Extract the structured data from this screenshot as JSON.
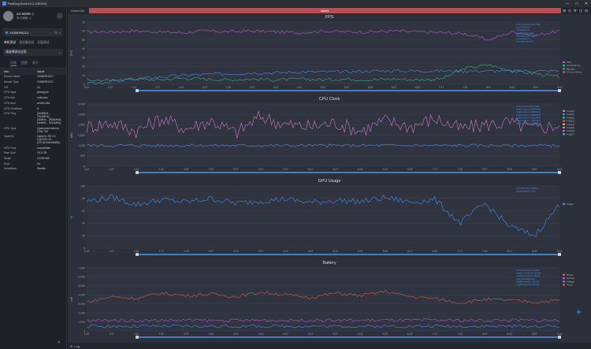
{
  "window": {
    "title": "PerfDog Evolv10.2.240319)",
    "controls": [
      "—",
      "□",
      "✕"
    ]
  },
  "user": {
    "name": "oei 5ei8le ◇",
    "status": "未订阅版 ⊥",
    "action_icon": "arrow-right"
  },
  "device": {
    "name": "2406ERN21C",
    "icons": [
      "⊡",
      "⌕"
    ]
  },
  "modes": {
    "items": [
      "单机测试",
      "多设备测试",
      "浮窗测试"
    ]
  },
  "app_select": {
    "label": "请选择测试应用"
  },
  "info_tabs": [
    "设备",
    "信息",
    "关于"
  ],
  "info_table": {
    "headers": [
      "Info",
      "Value"
    ],
    "rows": [
      [
        "Device Name",
        "2406ERN21C"
      ],
      [
        "Device Type",
        "2406ERN21C"
      ],
      [
        "OS",
        "14"
      ],
      [
        "CPU Type",
        "pineapple"
      ],
      [
        "CPU Info",
        "unknown"
      ],
      [
        "CPU Arch",
        "arm64-v8a"
      ],
      [
        "CPU CoreNum",
        "8"
      ],
      [
        "CPU Freq",
        "[0m3MHz - 3014MHz]\n[40MHz - 2803MHz]\n[40MHz - 3014MHz]"
      ],
      [
        "GPU Type",
        "Qualcomm Adreno\n(TM) 735"
      ],
      [
        "OpenGL",
        "OpenGL ES 3.2\nV@0762.33\n(GIT@14a1f0e89b)"
      ],
      [
        "GPU Freq",
        "unavailable"
      ],
      [
        "Ram Size",
        "15.0 GB"
      ],
      [
        "Swap",
        "10239 MB"
      ],
      [
        "Root",
        "No"
      ],
      [
        "SerialNum",
        "f9eef4e"
      ]
    ]
  },
  "top": {
    "tabs": [
      "DeviceTab"
    ],
    "label": "label1",
    "icons": [
      "⊞",
      "◷",
      "⚙",
      "◫",
      "⊟"
    ]
  },
  "bottom": {
    "label": "Log"
  },
  "colors": {
    "line_blue": "#4a8fe7",
    "fps_magenta": "#b85ad0",
    "fps_green": "#3fae7a",
    "battery_orange": "#c8644a",
    "red_bar": "#b55054"
  },
  "chart_data": [
    {
      "type": "line",
      "title": "FPS",
      "ylabel": "FPS",
      "ylim": [
        0,
        70
      ],
      "y_ticks": [
        "70",
        "60",
        "50",
        "40",
        "30",
        "20",
        "10",
        "0"
      ],
      "x_ticks": [
        "1:02",
        "1:37",
        "1:12",
        "2:17",
        "2:42",
        "3:07",
        "3:32",
        "3:57",
        "4:22",
        "4:47",
        "5:12",
        "5:37",
        "6:02",
        "6:27",
        "6:52",
        "7:17",
        "7:42",
        "8:07",
        "8:32",
        "8:57",
        "9:13"
      ],
      "stats_lines": [
        "Fl 23.310:23:2 60.9000",
        "Avg(FPS)60.0",
        "Var(FPS)3.0",
        "Jank(/10min)10.4",
        "BigJank(/10min)4.3",
        "Stutter(%)1.1",
        "SmoothIndex 94"
      ],
      "legend": [
        "FPS",
        "Jank(/10min)",
        "BigJank",
        "FTime>100ms"
      ],
      "series": [
        {
          "values": [
            59,
            59,
            60,
            59,
            58,
            60,
            59,
            60,
            59,
            58,
            60,
            59,
            59,
            60,
            59,
            58,
            57,
            50,
            59,
            55,
            60
          ]
        },
        {
          "values": [
            5,
            4,
            6,
            5,
            7,
            6,
            5,
            6,
            5,
            6,
            5,
            6,
            5,
            6,
            5,
            6,
            18,
            22,
            15,
            12,
            8
          ]
        },
        {
          "values": [
            0,
            3,
            6,
            8,
            10,
            11,
            12,
            13,
            13,
            14,
            14,
            14,
            15,
            15,
            15,
            15,
            15,
            15,
            15,
            15,
            15
          ]
        }
      ]
    },
    {
      "type": "line",
      "title": "CPU Clock",
      "ylabel": "MHz",
      "ylim": [
        0,
        3000
      ],
      "y_ticks": [
        "3,000",
        "2,500",
        "2,000",
        "1,500",
        "1,000",
        "500",
        "0"
      ],
      "x_ticks": [
        "1:02",
        "1:37",
        "2:12",
        "2:42",
        "3:07",
        "3:32",
        "3:57",
        "4:22",
        "4:47",
        "5:12",
        "5:37",
        "6:02",
        "6:27",
        "6:52",
        "7:17",
        "7:42",
        "8:07",
        "8:32",
        "8:57",
        "9:13"
      ],
      "stats_lines": [
        "Fl 23:10:23:2:24 5000",
        "Avg(Freq)1.2 2044MHz",
        "Avg(Freq)1.2 2048MHz",
        "Avg(Freq)1.2 1908MHz",
        "Avg(Freq)1.2 3012MHz",
        "Avg(Freq)1.2 1981MHz",
        "Avg(Freq)1.2 1980MHz"
      ],
      "legend": [
        "Freq[0]",
        "Freq[1]",
        "Freq[2]",
        "Freq[3]",
        "Freq[4]",
        "Freq[5]",
        "Freq[6]",
        "Freq[7]"
      ],
      "series": [
        {
          "values": [
            1900,
            2100,
            1700,
            2300,
            1800,
            2200,
            1600,
            2400,
            2000,
            1900,
            2100,
            1700,
            2200,
            1900,
            2300,
            1800,
            2000,
            2100,
            1800,
            2000
          ]
        },
        {
          "values": [
            1000,
            1000,
            1000,
            1000,
            1000,
            1000,
            1000,
            1000,
            1000,
            1000,
            1000,
            1000,
            1000,
            1000,
            1000,
            1000,
            1000,
            1000,
            1000,
            1000
          ]
        }
      ]
    },
    {
      "type": "line",
      "title": "GPU Usage",
      "ylabel": "%",
      "ylim": [
        0,
        100
      ],
      "y_ticks": [
        "100",
        "80",
        "60",
        "40",
        "20",
        "0"
      ],
      "x_ticks": [
        "1:02",
        "1:27",
        "1:50",
        "2:17",
        "2:43",
        "3:07",
        "3:32",
        "3:57",
        "4:22",
        "4:47",
        "5:12",
        "5:37",
        "6:02",
        "6:27",
        "6:52",
        "7:17",
        "7:42",
        "8:07",
        "8:32",
        "9:13"
      ],
      "stats_lines": [
        "Fl 23:10:23:2:4 5000",
        "Avg(Usage)0.71%"
      ],
      "legend": [
        "Usage"
      ],
      "series": [
        {
          "values": [
            75,
            82,
            70,
            78,
            74,
            80,
            72,
            76,
            79,
            73,
            77,
            75,
            81,
            74,
            78,
            40,
            72,
            35,
            20,
            70
          ]
        }
      ]
    },
    {
      "type": "line",
      "title": "Battery",
      "ylabel": "mW",
      "ylim": [
        0,
        7000
      ],
      "y_ticks": [
        "7,000",
        "6,000",
        "5,000",
        "4,000",
        "3,000",
        "2,000",
        "1,000",
        "0"
      ],
      "x_ticks": [
        "1:02",
        "1:37",
        "2:12",
        "2:42",
        "3:07",
        "3:32",
        "3:57",
        "4:22",
        "4:47",
        "5:12",
        "5:37",
        "6:02",
        "6:27",
        "6:52",
        "7:17",
        "7:42",
        "8:07",
        "8:32",
        "8:57",
        "9:13"
      ],
      "stats_lines": [
        "Fl 23:10:23:10:1 5000",
        "Avg(Power)0.18 19mW",
        "Avg(Current)1.0 46mA",
        "Avg(Voltage)2.04 ...",
        "Avg(Power)2.1 36mW",
        "Avg(Power)1.0 38mW"
      ],
      "legend": [
        "Power",
        "Current",
        "Voltage",
        "Temp"
      ],
      "series": [
        {
          "values": [
            3200,
            3800,
            3600,
            4200,
            3900,
            4100,
            3800,
            4300,
            4000,
            3700,
            4200,
            3900,
            4400,
            3800,
            3600,
            3100,
            3500,
            3400,
            3200,
            3400
          ]
        },
        {
          "values": [
            1100,
            1200,
            1150,
            1180,
            1200,
            1150,
            1170,
            1190,
            1160,
            1200,
            1180,
            1170,
            1190,
            1160,
            1200,
            1180,
            1170,
            1190,
            1160,
            1180
          ]
        },
        {
          "values": [
            500,
            520,
            510,
            515,
            520,
            510,
            518,
            512,
            516,
            520,
            514,
            512,
            518,
            510,
            520,
            515,
            512,
            518,
            510,
            515
          ]
        }
      ]
    }
  ]
}
